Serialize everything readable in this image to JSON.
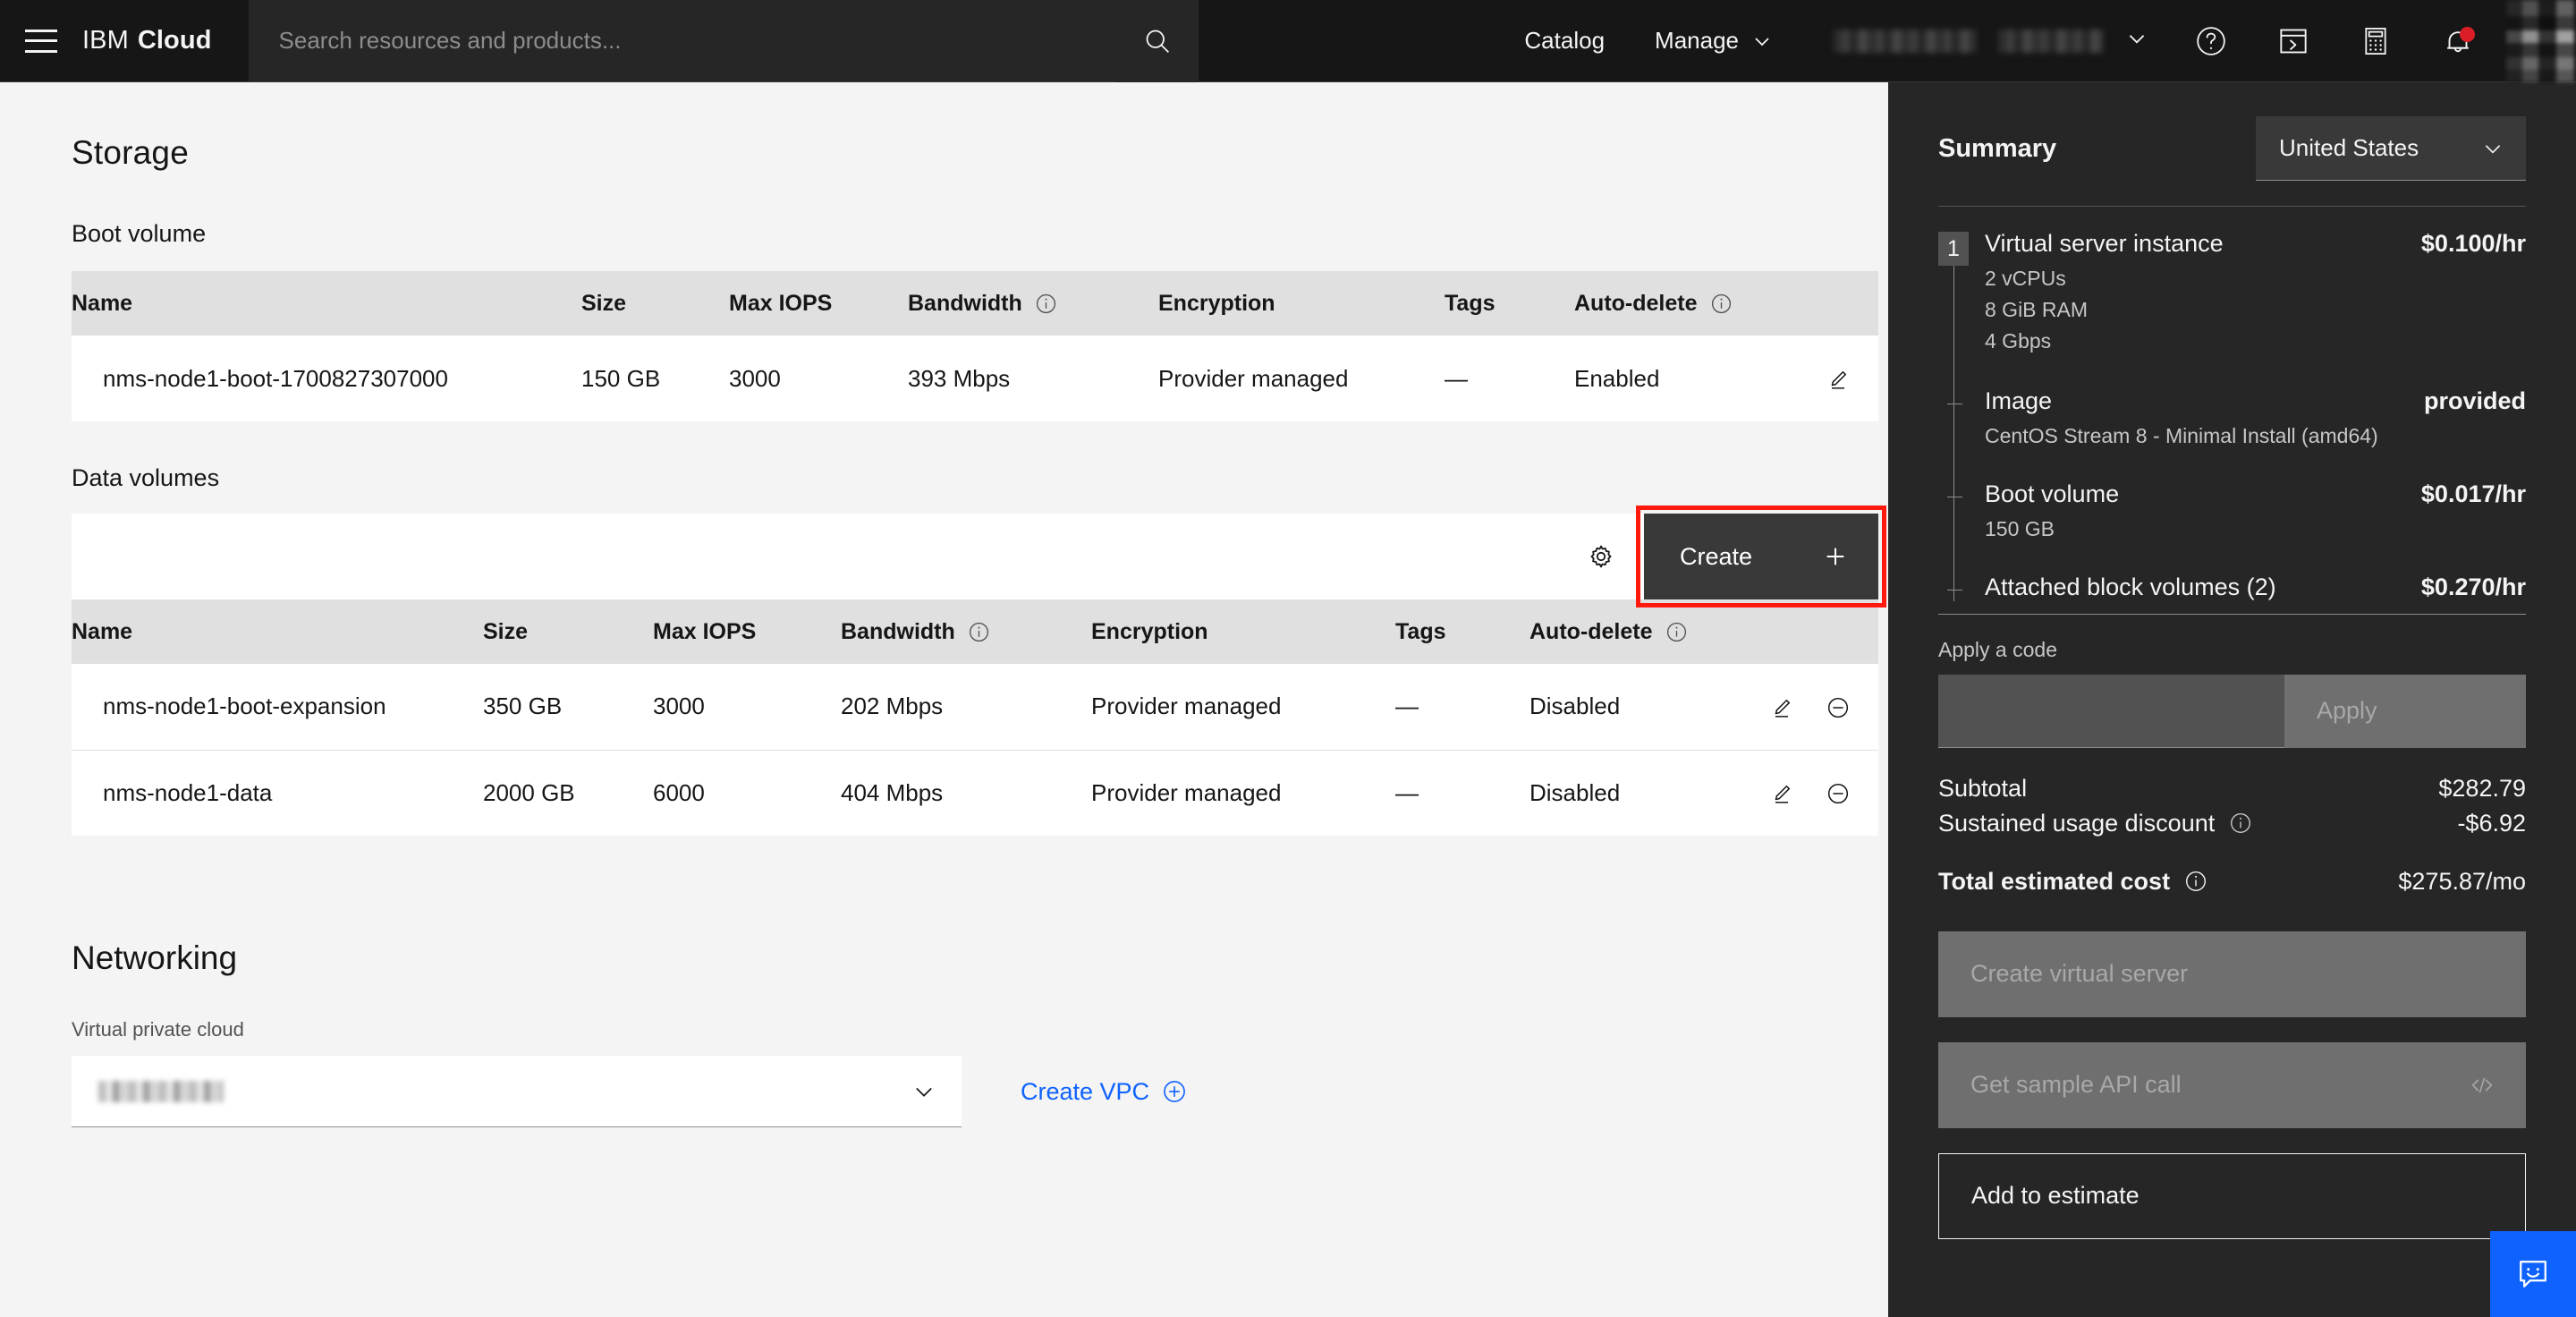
{
  "header": {
    "brand_ibm": "IBM",
    "brand_cloud": "Cloud",
    "search_placeholder": "Search resources and products...",
    "catalog": "Catalog",
    "manage": "Manage",
    "account_redacted": "",
    "icons": {
      "menu": "hamburger-icon",
      "search": "search-icon",
      "help": "help-icon",
      "shell": "cloud-shell-icon",
      "calculator": "calculator-icon",
      "notifications": "bell-icon",
      "avatar": "user-avatar"
    }
  },
  "main": {
    "page_title": "Storage",
    "boot_volume": {
      "title": "Boot volume",
      "columns": [
        "Name",
        "Size",
        "Max IOPS",
        "Bandwidth",
        "Encryption",
        "Tags",
        "Auto-delete"
      ],
      "rows": [
        {
          "name": "nms-node1-boot-1700827307000",
          "size": "150 GB",
          "max_iops": "3000",
          "bandwidth": "393 Mbps",
          "encryption": "Provider managed",
          "tags": "—",
          "auto_delete": "Enabled"
        }
      ]
    },
    "data_volumes": {
      "title": "Data volumes",
      "create_label": "Create",
      "columns": [
        "Name",
        "Size",
        "Max IOPS",
        "Bandwidth",
        "Encryption",
        "Tags",
        "Auto-delete"
      ],
      "rows": [
        {
          "name": "nms-node1-boot-expansion",
          "size": "350 GB",
          "max_iops": "3000",
          "bandwidth": "202 Mbps",
          "encryption": "Provider managed",
          "tags": "—",
          "auto_delete": "Disabled"
        },
        {
          "name": "nms-node1-data",
          "size": "2000 GB",
          "max_iops": "6000",
          "bandwidth": "404 Mbps",
          "encryption": "Provider managed",
          "tags": "—",
          "auto_delete": "Disabled"
        }
      ]
    },
    "networking": {
      "title": "Networking",
      "vpc_label": "Virtual private cloud",
      "vpc_value_redacted": "",
      "create_vpc": "Create VPC"
    }
  },
  "summary": {
    "title": "Summary",
    "region": "United States",
    "items": [
      {
        "badge": "1",
        "title": "Virtual server instance",
        "price": "$0.100/hr",
        "details": [
          "2 vCPUs",
          "8 GiB RAM",
          "4 Gbps"
        ]
      },
      {
        "title": "Image",
        "price": "provided",
        "details": [
          "CentOS Stream 8 - Minimal Install (amd64)"
        ]
      },
      {
        "title": "Boot volume",
        "price": "$0.017/hr",
        "details": [
          "150 GB"
        ]
      },
      {
        "title": "Attached block volumes (2)",
        "price": "$0.270/hr",
        "details": []
      }
    ],
    "apply_code_label": "Apply a code",
    "apply_code_value": "",
    "apply_button": "Apply",
    "subtotal_label": "Subtotal",
    "subtotal_value": "$282.79",
    "discount_label": "Sustained usage discount",
    "discount_value": "-$6.92",
    "total_label": "Total estimated cost",
    "total_value": "$275.87/mo",
    "create_vs_button": "Create virtual server",
    "api_button": "Get sample API call",
    "estimate_button": "Add to estimate"
  },
  "colors": {
    "header_bg": "#161616",
    "summary_bg": "#262626",
    "create_btn_bg": "#393939",
    "highlight": "#ff1a0d",
    "link_blue": "#0f62fe",
    "notification_red": "#da1e28",
    "table_header_bg": "#e0e0e0"
  }
}
